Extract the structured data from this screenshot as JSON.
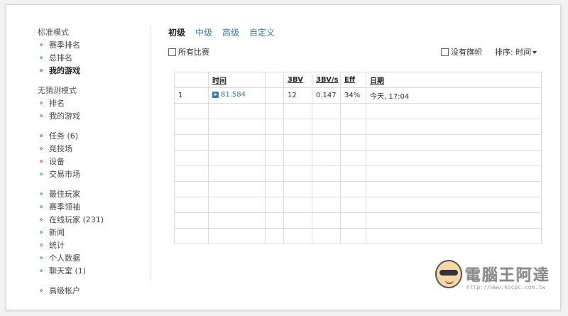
{
  "sidebar": {
    "sections": [
      {
        "heading": "标准模式",
        "items": [
          {
            "label": "赛季排名",
            "color": "blue"
          },
          {
            "label": "总排名",
            "color": "blue"
          },
          {
            "label": "我的游戏",
            "color": "blue",
            "active": true
          }
        ]
      },
      {
        "heading": "无猜测模式",
        "items": [
          {
            "label": "排名",
            "color": "blue"
          },
          {
            "label": "我的游戏",
            "color": "blue"
          }
        ]
      },
      {
        "heading": "",
        "items": [
          {
            "label": "任务 (6)",
            "color": "red"
          },
          {
            "label": "竞技场",
            "color": "red"
          },
          {
            "label": "设备",
            "color": "red"
          },
          {
            "label": "交易市场",
            "color": "blue"
          }
        ]
      },
      {
        "heading": "",
        "items": [
          {
            "label": "最佳玩家",
            "color": "blue"
          },
          {
            "label": "赛季领袖",
            "color": "blue"
          },
          {
            "label": "在线玩家 (231)",
            "color": "blue"
          },
          {
            "label": "新闻",
            "color": "blue"
          },
          {
            "label": "统计",
            "color": "blue"
          },
          {
            "label": "个人数据",
            "color": "blue"
          },
          {
            "label": "聊天室 (1)",
            "color": "blue"
          }
        ]
      },
      {
        "heading": "",
        "items": [
          {
            "label": "高级帐户",
            "color": "blue"
          }
        ]
      }
    ]
  },
  "tabs": [
    "初级",
    "中级",
    "高级",
    "自定义"
  ],
  "active_tab": 0,
  "toolbar": {
    "all_matches": "所有比赛",
    "no_flags": "没有旗帜",
    "sort_label": "排序: 时间"
  },
  "table": {
    "headers": [
      "",
      "时间",
      "",
      "3BV",
      "3BV/s",
      "Eff",
      "日期"
    ],
    "rows": [
      [
        "1",
        "81.584",
        "",
        "12",
        "0.147",
        "34%",
        "今天, 17:04"
      ]
    ],
    "empty_rows": 9
  },
  "watermark": {
    "title": "電腦王阿達",
    "url": "http://www.kocpc.com.tw"
  }
}
